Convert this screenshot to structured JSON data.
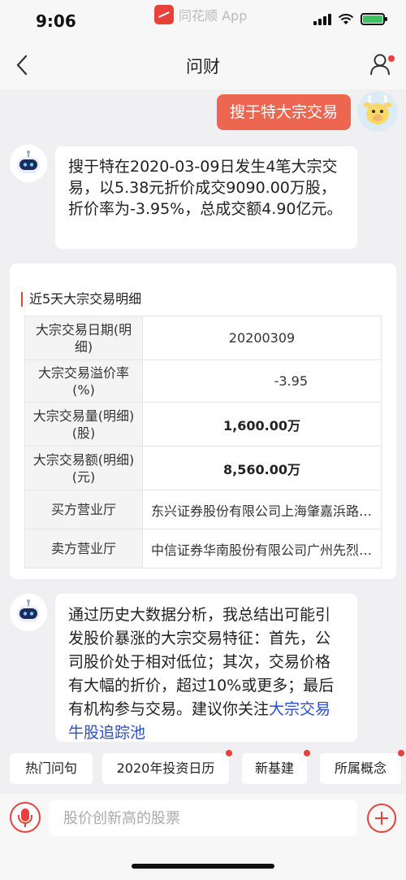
{
  "status_bar": {
    "time": "9:06",
    "app_name": "同花顺 App"
  },
  "nav": {
    "title": "问财"
  },
  "user_message": "搜于特大宗交易",
  "answer": {
    "text": "搜于特在2020-03-09日发生4笔大宗交易，以5.38元折价成交9090.00万股，折价率为-3.95%，总成交额4.90亿元。"
  },
  "detail_card": {
    "title": "近5天大宗交易明细",
    "rows": [
      {
        "key": "大宗交易日期(明细)",
        "value": "20200309"
      },
      {
        "key": "大宗交易溢价率(%)",
        "value": "-3.95"
      },
      {
        "key": "大宗交易量(明细)(股)",
        "value": "1,600.00万"
      },
      {
        "key": "大宗交易额(明细)(元)",
        "value": "8,560.00万"
      },
      {
        "key": "买方营业厅",
        "value": "东兴证券股份有限公司上海肇嘉浜路证券营业部"
      },
      {
        "key": "卖方营业厅",
        "value": "中信证券华南股份有限公司广州先烈中路证券营业部"
      }
    ]
  },
  "analysis": {
    "text": "通过历史大数据分析，我总结出可能引发股价暴涨的大宗交易特征：首先，公司股价处于相对低位；其次，交易价格有大幅的折价，超过10%或更多；最后有机构参与交易。建议你关注",
    "link": "大宗交易牛股追踪池"
  },
  "chips": [
    {
      "label": "热门问句"
    },
    {
      "label": "2020年投资日历"
    },
    {
      "label": "新基建"
    },
    {
      "label": "所属概念"
    }
  ],
  "input": {
    "placeholder": "股价创新高的股票"
  },
  "colors": {
    "accent": "#e8403a",
    "user_bubble": "#ec6650",
    "link": "#2a4fc9"
  }
}
